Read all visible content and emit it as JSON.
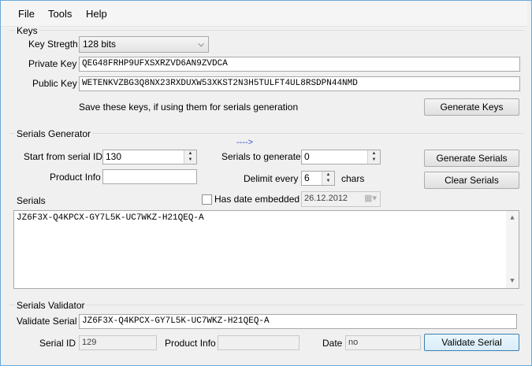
{
  "menu": {
    "file": "File",
    "tools": "Tools",
    "help": "Help"
  },
  "keys": {
    "group_title": "Keys",
    "key_strength_label": "Key Stregth",
    "key_strength_value": "128 bits",
    "private_key_label": "Private Key",
    "private_key_value": "QEG48FRHP9UFXSXRZVD6AN9ZVDCA",
    "public_key_label": "Public Key",
    "public_key_value": "WETENKVZBG3Q8NX23RXDUXW53XKST2N3H5TULFT4UL8RSDPN44NMD",
    "save_hint": "Save these keys, if using them for serials generation",
    "generate_keys_button": "Generate Keys"
  },
  "generator": {
    "group_title": "Serials Generator",
    "arrow_hint": "---->",
    "start_label": "Start from serial ID",
    "start_value": "130",
    "serials_to_generate_label": "Serials to generate",
    "serials_to_generate_value": "0",
    "generate_serials_button": "Generate Serials",
    "product_info_label": "Product Info",
    "product_info_value": "",
    "delimit_label": "Delimit every",
    "delimit_value": "6",
    "chars_label": "chars",
    "clear_serials_button": "Clear Serials",
    "serials_label": "Serials",
    "has_date_label": "Has date embedded",
    "date_value": "26.12.2012",
    "serials_text": "JZ6F3X-Q4KPCX-GY7L5K-UC7WKZ-H21QEQ-A"
  },
  "validator": {
    "group_title": "Serials Validator",
    "validate_label": "Validate Serial",
    "validate_value": "JZ6F3X-Q4KPCX-GY7L5K-UC7WKZ-H21QEQ-A",
    "serial_id_label": "Serial ID",
    "serial_id_value": "129",
    "product_info_label": "Product Info",
    "product_info_value": "",
    "date_label": "Date",
    "date_value": "no",
    "validate_button": "Validate Serial"
  }
}
